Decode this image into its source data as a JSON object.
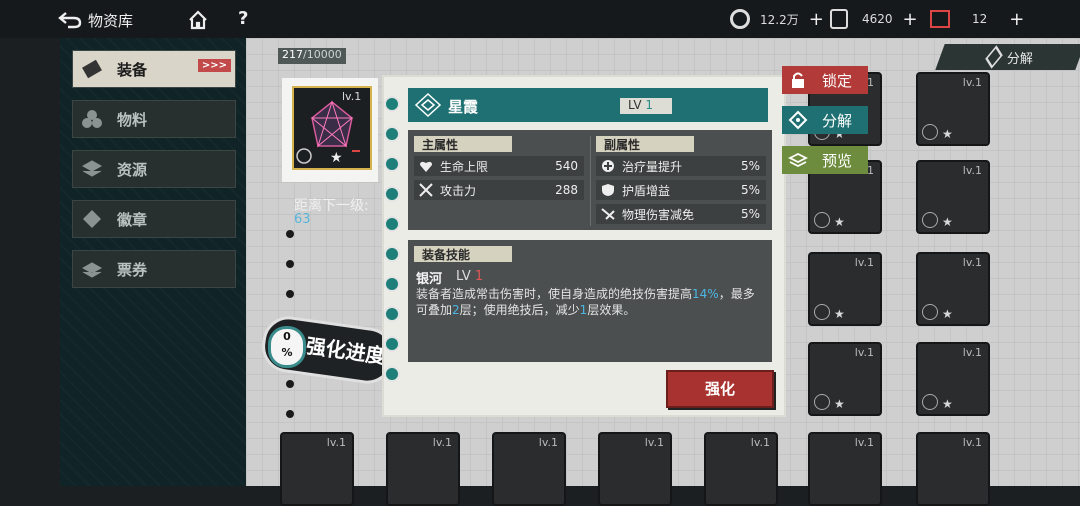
{
  "topbar": {
    "back_label": "物资库",
    "home_icon": "home-icon",
    "help_label": "?",
    "resources": [
      {
        "icon": "coin-icon",
        "value": "12.2万",
        "plus": "+"
      },
      {
        "icon": "ticket-icon",
        "value": "4620",
        "plus": "+"
      },
      {
        "icon": "card-icon",
        "value": "12",
        "plus": "+"
      }
    ]
  },
  "sidebar": {
    "items": [
      {
        "label": "装备",
        "icon": "equipment-icon",
        "active": true,
        "arrows": ">>>"
      },
      {
        "label": "物料",
        "icon": "material-icon",
        "active": false
      },
      {
        "label": "资源",
        "icon": "resource-icon",
        "active": false
      },
      {
        "label": "徽章",
        "icon": "badge-icon",
        "active": false
      },
      {
        "label": "票券",
        "icon": "voucher-icon",
        "active": false
      }
    ]
  },
  "inventory": {
    "capacity_current": "217",
    "capacity_max": "/10000",
    "decompose_label": "分解",
    "cell_level": "lv.1"
  },
  "selected_item": {
    "level_tag": "lv.1",
    "next_level_label": "距离下一级:",
    "next_level_value": "63",
    "progress_percent": "0",
    "progress_unit": "%",
    "progress_label": "强化进度"
  },
  "detail": {
    "name": "星霞",
    "lv_prefix": "LV",
    "lv_value": "1",
    "main_attr_title": "主属性",
    "sub_attr_title": "副属性",
    "main_attrs": [
      {
        "icon": "heart-icon",
        "label": "生命上限",
        "value": "540"
      },
      {
        "icon": "swords-icon",
        "label": "攻击力",
        "value": "288"
      }
    ],
    "sub_attrs": [
      {
        "icon": "heal-icon",
        "label": "治疗量提升",
        "value": "5%"
      },
      {
        "icon": "shield-icon",
        "label": "护盾增益",
        "value": "5%"
      },
      {
        "icon": "damage-reduce-icon",
        "label": "物理伤害减免",
        "value": "5%"
      }
    ],
    "skill_title": "装备技能",
    "skill_name": "银河",
    "skill_lv_prefix": "LV",
    "skill_lv_value": "1",
    "skill_desc_1": "装备者造成常击伤害时，使自身造成的绝技伤害提高",
    "skill_desc_hl1": "14%",
    "skill_desc_2": "，最多可叠加",
    "skill_desc_hl2": "2",
    "skill_desc_3": "层；使用绝技后，减少",
    "skill_desc_hl3": "1",
    "skill_desc_4": "层效果。",
    "enhance_label": "强化"
  },
  "actions": {
    "lock_label": "锁定",
    "decompose_label": "分解",
    "preview_label": "预览"
  },
  "colors": {
    "teal": "#1f7072",
    "red": "#a8322f",
    "lock_red": "#b23a38",
    "preview_green": "#6e8c3e",
    "highlight_blue": "#4db6e4"
  }
}
